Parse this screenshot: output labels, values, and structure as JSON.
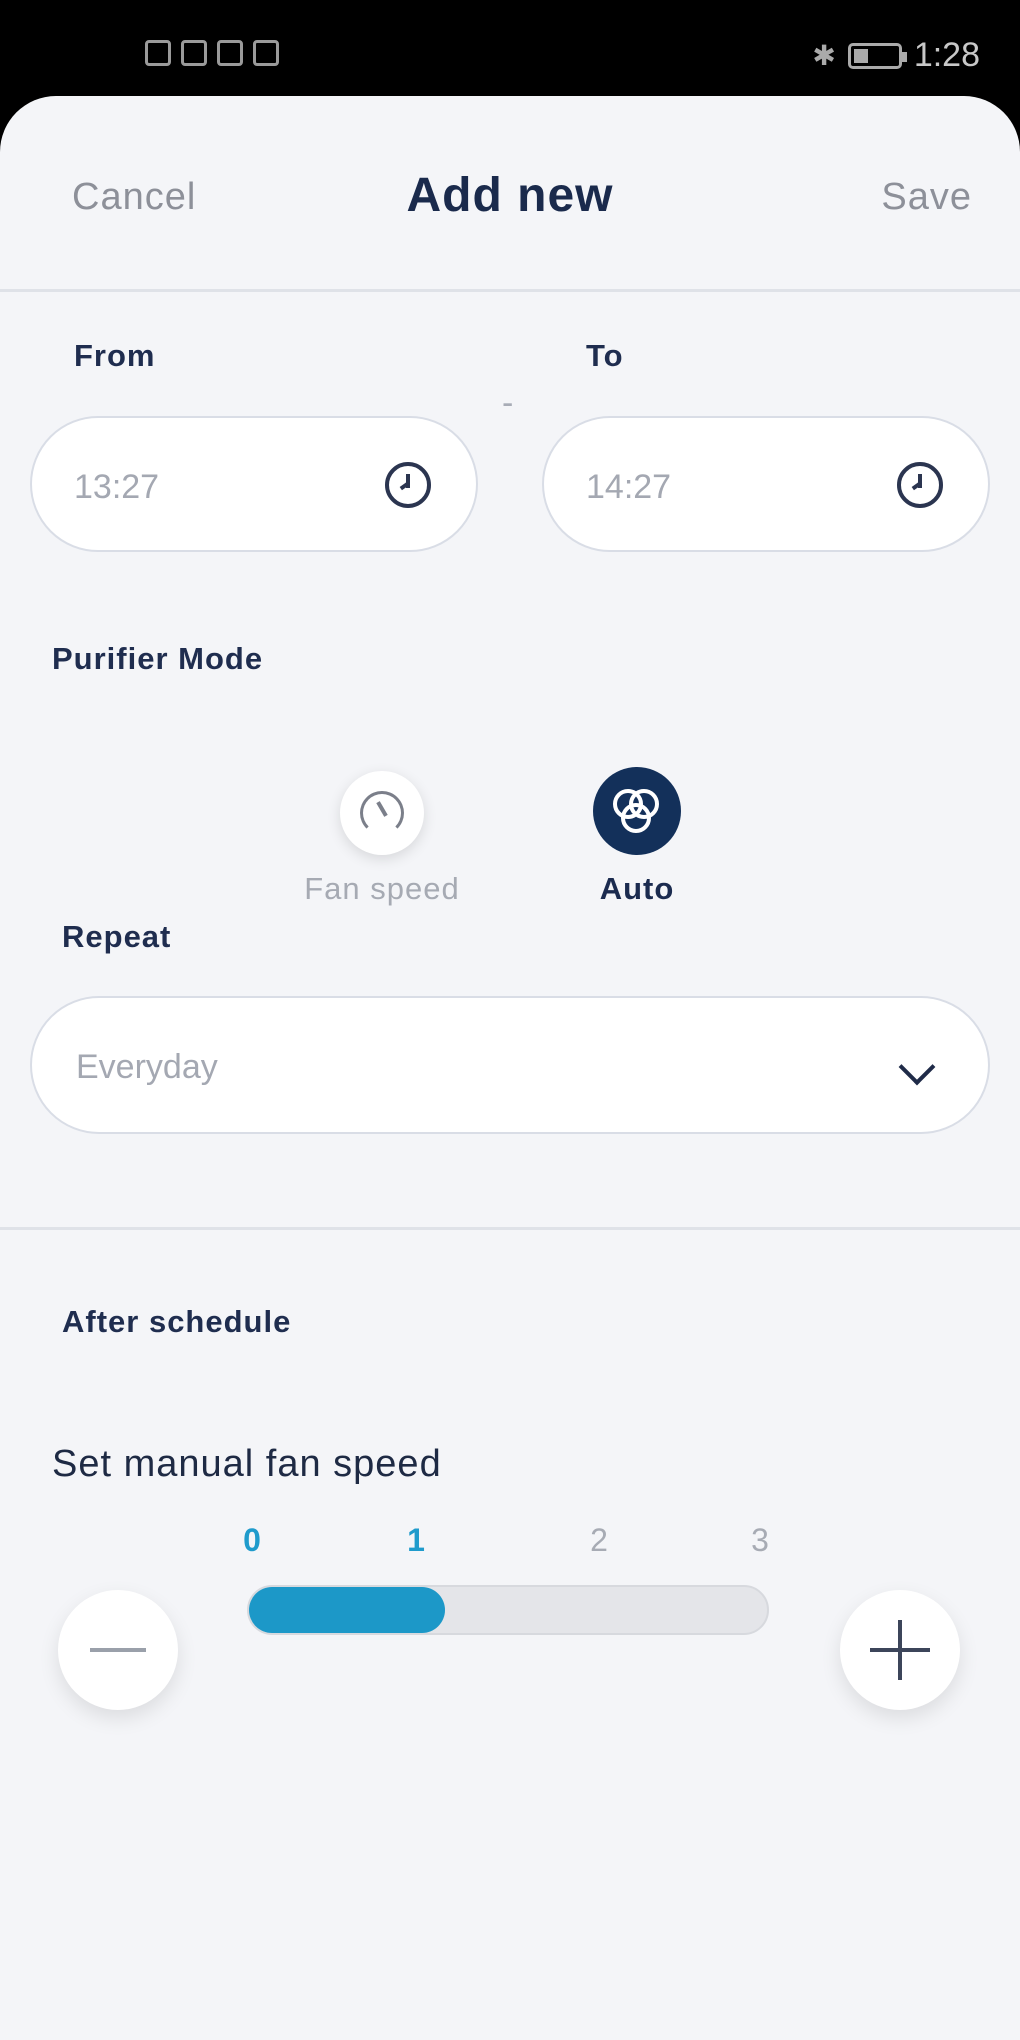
{
  "status_bar": {
    "time": "1:28"
  },
  "header": {
    "cancel": "Cancel",
    "title": "Add new",
    "save": "Save"
  },
  "time_range": {
    "from_label": "From",
    "from_value": "13:27",
    "to_label": "To",
    "to_value": "14:27",
    "separator": "-"
  },
  "purifier_mode": {
    "label": "Purifier Mode",
    "options": [
      {
        "label": "Fan speed",
        "icon": "fan-speed-icon",
        "selected": false
      },
      {
        "label": "Auto",
        "icon": "auto-mode-icon",
        "selected": true
      }
    ]
  },
  "repeat": {
    "label": "Repeat",
    "value": "Everyday"
  },
  "after_schedule": {
    "label": "After schedule",
    "fan_speed_label": "Set manual fan speed",
    "ticks": [
      "0",
      "1",
      "2",
      "3"
    ],
    "level": 1,
    "max": 3
  },
  "colors": {
    "accent": "#1c98c8",
    "navy": "#13305a",
    "background": "#f4f5f8"
  }
}
